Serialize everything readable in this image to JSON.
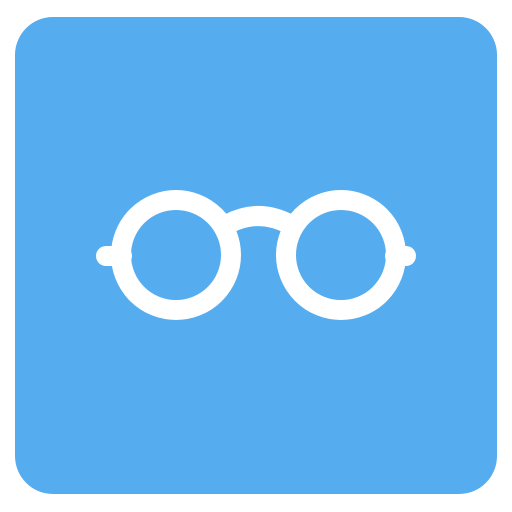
{
  "icon": {
    "name": "glasses-icon",
    "background_color": "#55ACEE",
    "glyph_color": "#FFFFFF"
  }
}
